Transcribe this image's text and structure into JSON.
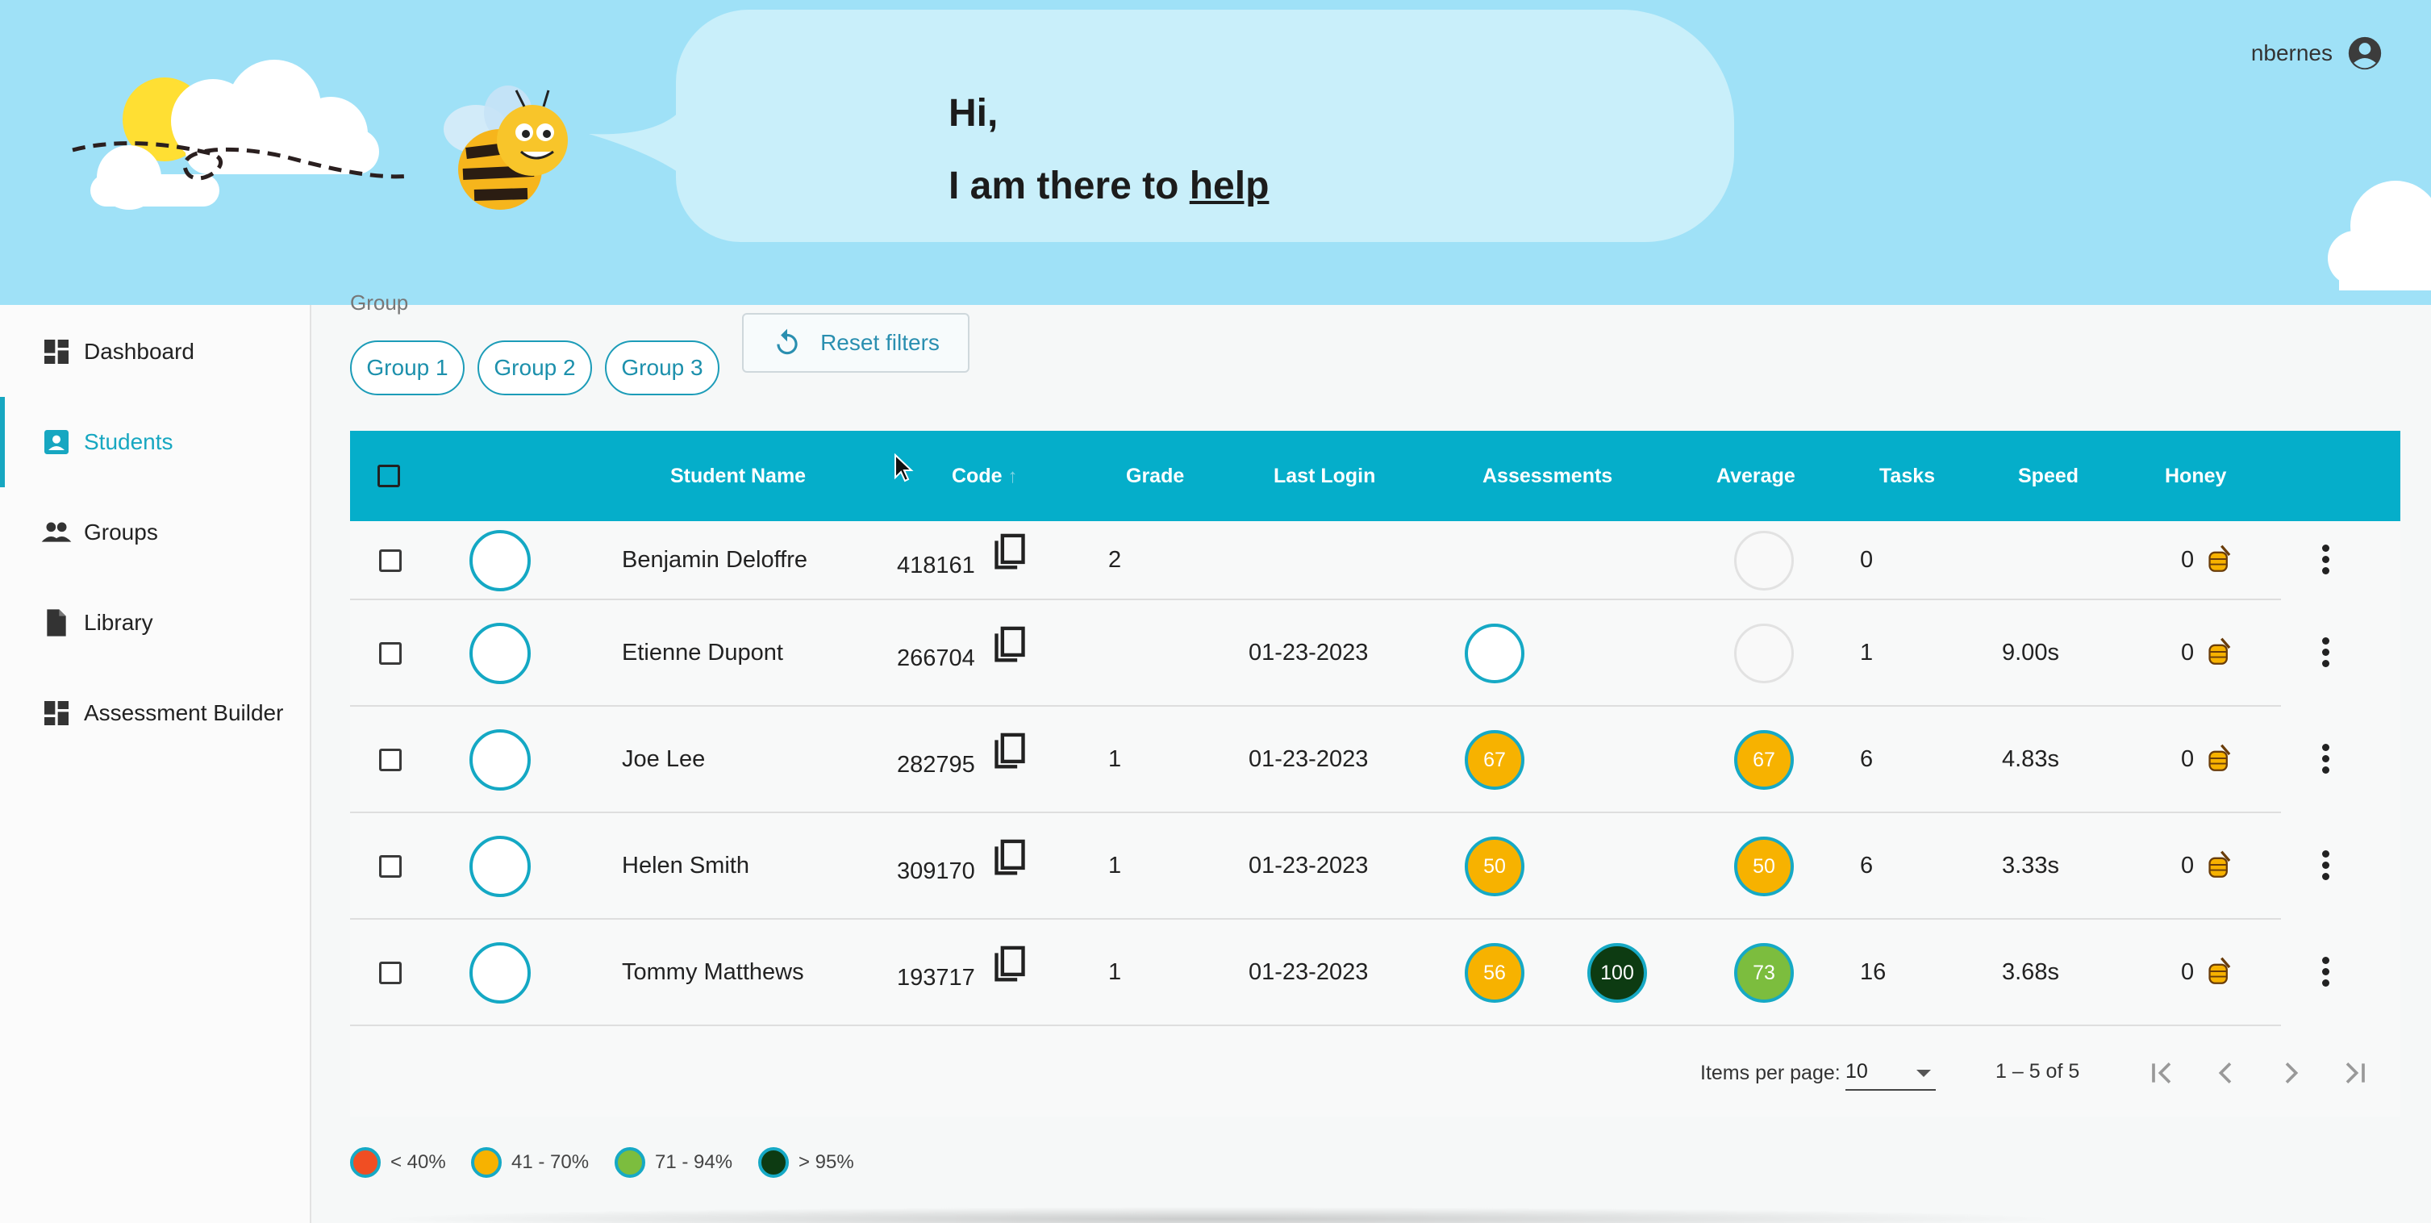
{
  "header": {
    "greeting_line1": "Hi,",
    "greeting_line2_prefix": "I am there to ",
    "greeting_link": "help",
    "username": "nbernes"
  },
  "sidebar": {
    "items": [
      {
        "label": "Dashboard",
        "icon": "dashboard-icon",
        "active": false
      },
      {
        "label": "Students",
        "icon": "student-icon",
        "active": true
      },
      {
        "label": "Groups",
        "icon": "groups-icon",
        "active": false
      },
      {
        "label": "Library",
        "icon": "file-icon",
        "active": false
      },
      {
        "label": "Assessment Builder",
        "icon": "dashboard-icon",
        "active": false
      }
    ]
  },
  "filters": {
    "group_label": "Group",
    "chips": [
      "Group 1",
      "Group 2",
      "Group 3"
    ],
    "reset_label": "Reset filters"
  },
  "table": {
    "columns": [
      "Student Name",
      "Code",
      "Grade",
      "Last Login",
      "Assessments",
      "Average",
      "Tasks",
      "Speed",
      "Honey"
    ],
    "sort_column": "Code",
    "rows": [
      {
        "name": "Benjamin Deloffre",
        "code": "418161",
        "grade": "2",
        "last_login": "",
        "assessments": [],
        "average": "",
        "tasks": "0",
        "speed": "",
        "honey": "0"
      },
      {
        "name": "Etienne Dupont",
        "code": "266704",
        "grade": "",
        "last_login": "01-23-2023",
        "assessments": [
          ""
        ],
        "average": "",
        "tasks": "1",
        "speed": "9.00s",
        "honey": "0"
      },
      {
        "name": "Joe Lee",
        "code": "282795",
        "grade": "1",
        "last_login": "01-23-2023",
        "assessments": [
          "67"
        ],
        "average": "67",
        "tasks": "6",
        "speed": "4.83s",
        "honey": "0"
      },
      {
        "name": "Helen Smith",
        "code": "309170",
        "grade": "1",
        "last_login": "01-23-2023",
        "assessments": [
          "50"
        ],
        "average": "50",
        "tasks": "6",
        "speed": "3.33s",
        "honey": "0"
      },
      {
        "name": "Tommy Matthews",
        "code": "193717",
        "grade": "1",
        "last_login": "01-23-2023",
        "assessments": [
          "56",
          "100"
        ],
        "average": "73",
        "tasks": "16",
        "speed": "3.68s",
        "honey": "0"
      }
    ]
  },
  "pagination": {
    "items_per_page_label": "Items per page:",
    "items_per_page": "10",
    "range": "1 – 5 of 5"
  },
  "legend": [
    {
      "label": "< 40%",
      "color": "#f04e23"
    },
    {
      "label": "41 - 70%",
      "color": "#f7b200"
    },
    {
      "label": "71 - 94%",
      "color": "#7cbd3e"
    },
    {
      "label": "> 95%",
      "color": "#0d3b12"
    }
  ],
  "colors": {
    "accent": "#05aeca",
    "header_bg": "#9fe1f7"
  }
}
